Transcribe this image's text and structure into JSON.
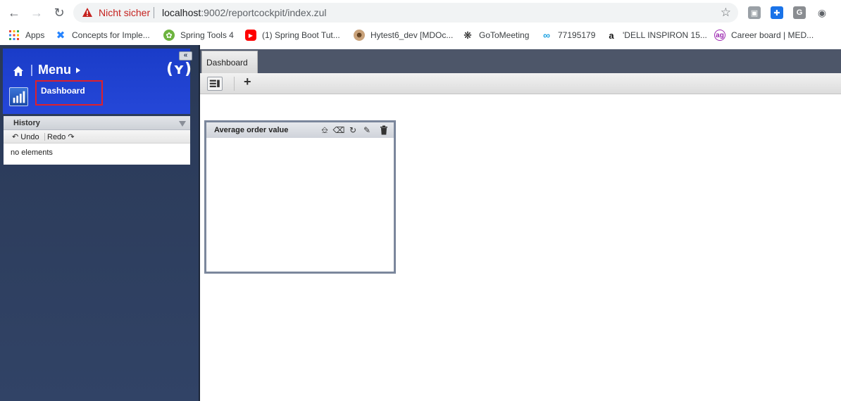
{
  "browser": {
    "insecure_label": "Nicht sicher",
    "url_host": "localhost",
    "url_rest": ":9002/reportcockpit/index.zul",
    "bookmarks": [
      {
        "label": "Apps"
      },
      {
        "label": "Concepts for Imple..."
      },
      {
        "label": "Spring Tools 4"
      },
      {
        "label": "(1) Spring Boot Tut..."
      },
      {
        "label": "Hytest6_dev [MDOc..."
      },
      {
        "label": "GoToMeeting"
      },
      {
        "label": "77195179"
      },
      {
        "label": "'DELL INSPIRON 15..."
      },
      {
        "label": "Career board | MED..."
      }
    ],
    "extensions": {
      "g_label": "G"
    }
  },
  "sidebar": {
    "menu_title": "Menu",
    "brand_logo": "(ʏ)",
    "dashboard_label": "Dashboard",
    "history": {
      "title": "History",
      "undo_label": "Undo",
      "redo_label": "Redo",
      "empty_text": "no elements"
    }
  },
  "main": {
    "tabs": [
      {
        "label": "Dashboard"
      }
    ],
    "widgets": [
      {
        "title": "Average order value"
      }
    ]
  },
  "colors": {
    "menu_blue": "#1a3cc8",
    "sidebar_navy": "#2a3956",
    "insecure_red": "#c5221f",
    "highlight_red": "#e0202a"
  }
}
